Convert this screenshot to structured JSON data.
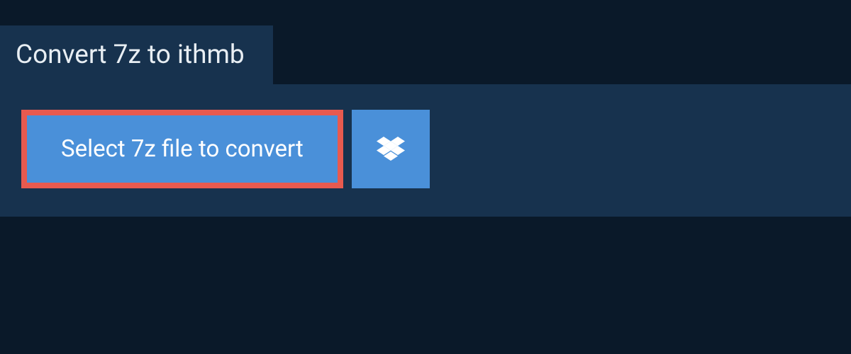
{
  "header": {
    "title": "Convert 7z to ithmb"
  },
  "actions": {
    "select_file_label": "Select 7z file to convert",
    "dropbox_icon": "dropbox-icon"
  },
  "colors": {
    "background": "#0a1929",
    "panel": "#17324e",
    "button": "#4a90d9",
    "highlight_border": "#e85a4f",
    "text_light": "#e8eef3",
    "text_white": "#ffffff"
  }
}
